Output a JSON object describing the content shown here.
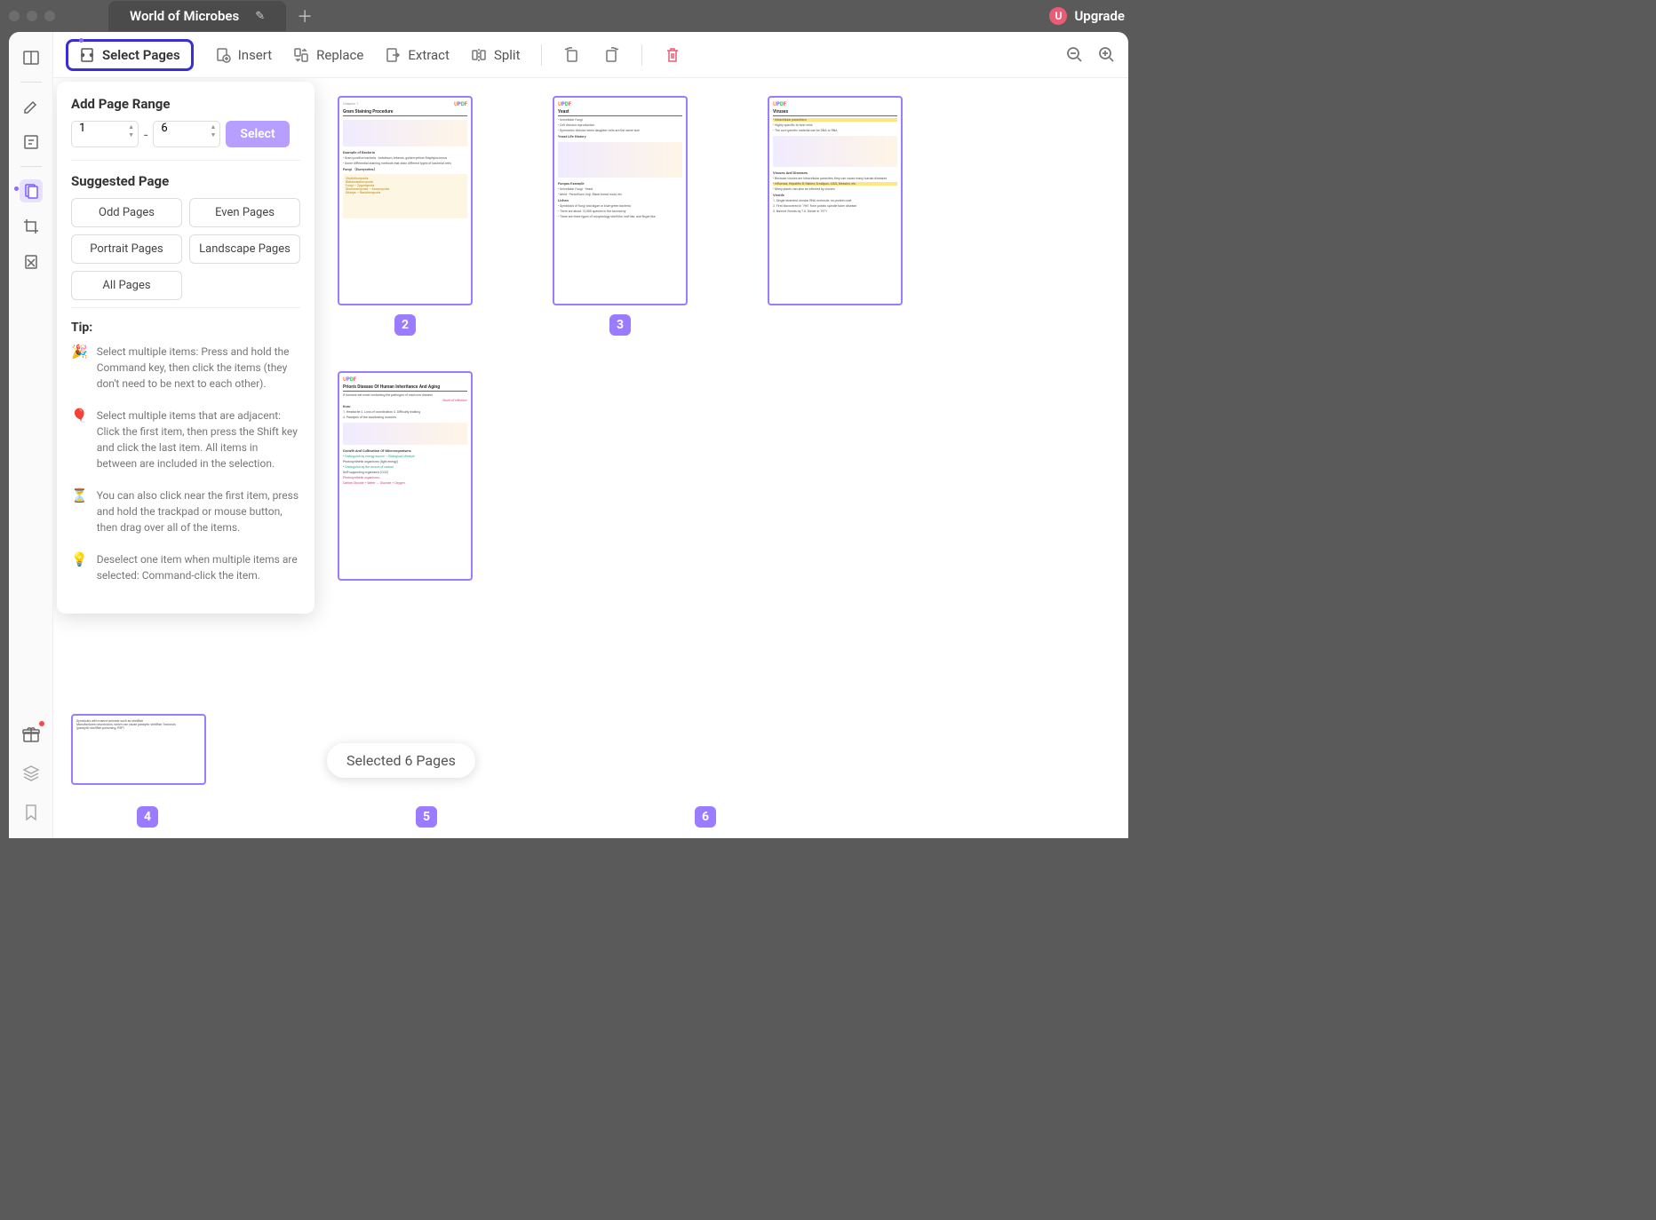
{
  "title_bar": {
    "tab_title": "World of Microbes",
    "upgrade_label": "Upgrade",
    "user_initial": "U"
  },
  "toolbar": {
    "select_pages": "Select Pages",
    "insert": "Insert",
    "replace": "Replace",
    "extract": "Extract",
    "split": "Split"
  },
  "panel": {
    "add_range_title": "Add Page Range",
    "range_from": "1",
    "range_to": "6",
    "select_btn": "Select",
    "suggested_title": "Suggested Page",
    "odd": "Odd Pages",
    "even": "Even Pages",
    "portrait": "Portrait Pages",
    "landscape": "Landscape Pages",
    "all": "All Pages",
    "tip_title": "Tip:",
    "tips": [
      {
        "emoji": "🎉",
        "text": "Select multiple items: Press and hold the Command key, then click the items (they don't need to be next to each other)."
      },
      {
        "emoji": "🎈",
        "text": "Select multiple items that are adjacent: Click the first item, then press the Shift key and click the last item. All items in between are included in the selection."
      },
      {
        "emoji": "⏳",
        "text": "You can also click near the first item, press and hold the trackpad or mouse button, then drag over all of the items."
      },
      {
        "emoji": "💡",
        "text": "Deselect one item when multiple items are selected: Command-click the item."
      }
    ]
  },
  "thumbs": {
    "page2": {
      "num": "2",
      "title": "Gram Staining Procedure",
      "sub1": "Example of Bacteria",
      "sub2": "Fungi （Eumycetes）"
    },
    "page3": {
      "num": "3",
      "title": "Yeast",
      "sub1": "Yeast Life History",
      "sub2": "Fungus Example",
      "sub3": "Lichen"
    },
    "page4": {
      "num": "4",
      "partial_line1": "Symbiosis with marine animals such as shellfish",
      "partial_line2": "Manufactures neurotoxins, which can cause paralytic shellfish Toxicosis",
      "partial_line3": "(paralytic shellfish poisoning, PSP)"
    },
    "page5": {
      "num": "5",
      "title": "Viruses",
      "sub1": "Viruses And Diseases",
      "sub2": "Viroids"
    },
    "page6": {
      "num": "6",
      "title": "Prion's Disease Of Human Inheritance And Aging",
      "sub1": "Kuru",
      "sub2": "Growth And Cultivation Of Microorganisms"
    }
  },
  "toast": {
    "text": "Selected 6 Pages"
  }
}
